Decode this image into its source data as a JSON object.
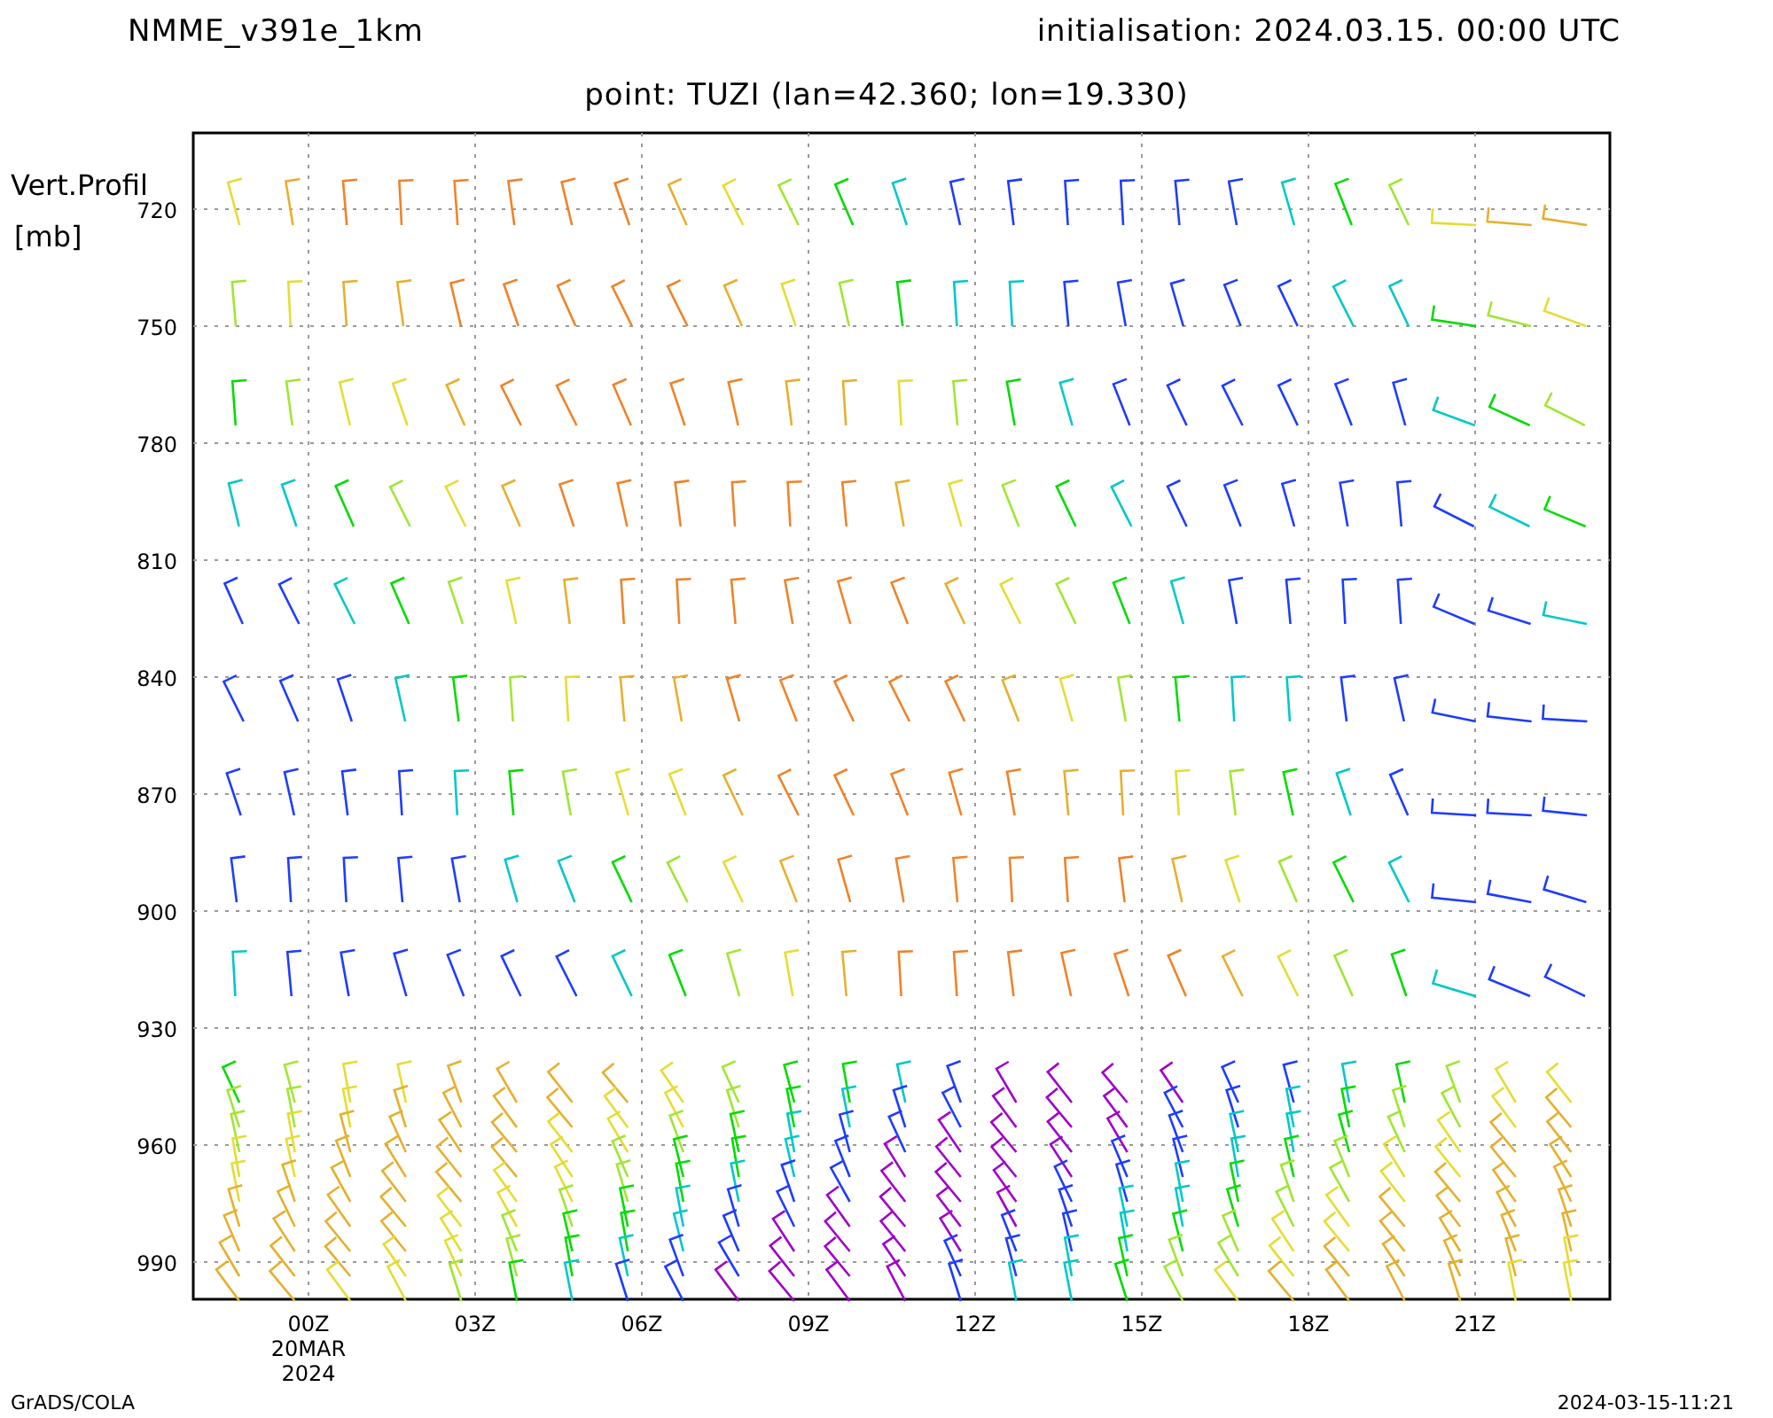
{
  "header": {
    "model": "NMME_v391e_1km",
    "initialisation": "initialisation: 2024.03.15. 00:00 UTC",
    "point": "point: TUZI (lan=42.360; lon=19.330)"
  },
  "y_axis": {
    "title": "Vert.Profil",
    "unit": "[mb]",
    "ticks": [
      "720",
      "750",
      "780",
      "810",
      "840",
      "870",
      "900",
      "930",
      "960",
      "990"
    ]
  },
  "x_axis": {
    "ticks": [
      {
        "label": "00Z",
        "date": "20MAR",
        "year": "2024"
      },
      {
        "label": "03Z"
      },
      {
        "label": "06Z"
      },
      {
        "label": "09Z"
      },
      {
        "label": "12Z"
      },
      {
        "label": "15Z"
      },
      {
        "label": "18Z"
      },
      {
        "label": "21Z"
      }
    ]
  },
  "footer": {
    "left": "GrADS/COLA",
    "right": "2024-03-15-11:21"
  }
}
